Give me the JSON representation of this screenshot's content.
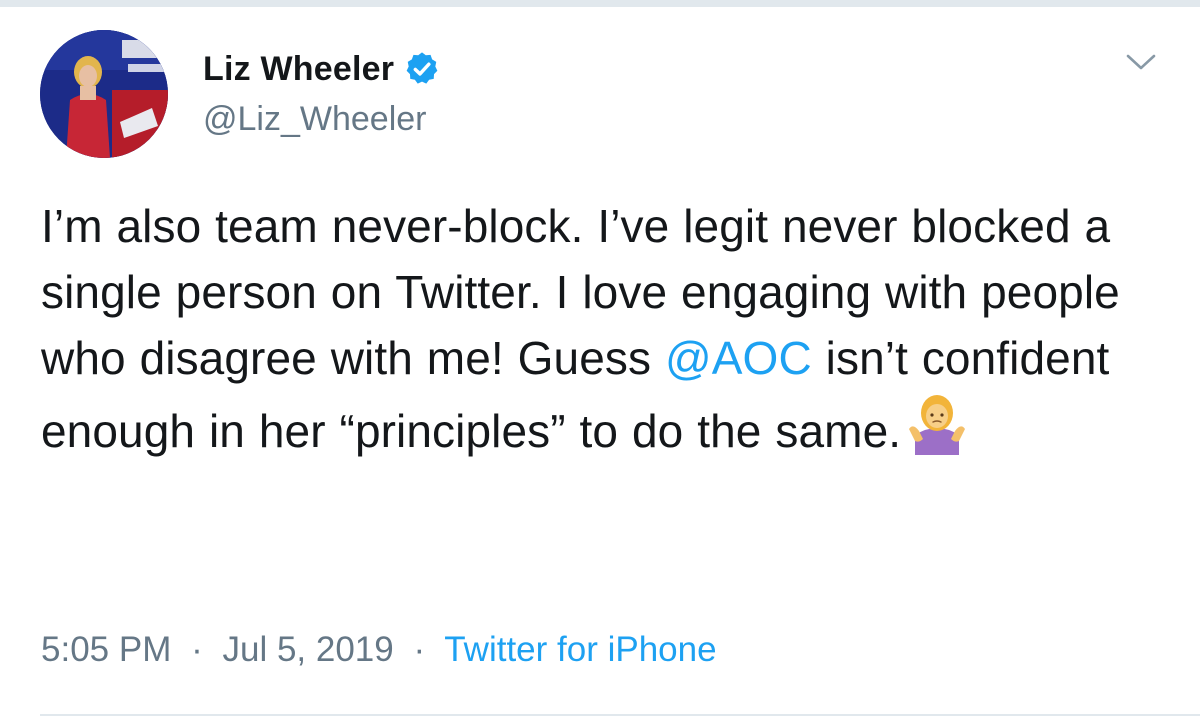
{
  "tweet": {
    "author": {
      "display_name": "Liz Wheeler",
      "handle": "@Liz_Wheeler",
      "verified": true
    },
    "text": {
      "part1": "I’m also team never-block. I’ve legit never blocked a single person on Twitter. I love engaging with people who disagree with me! Guess ",
      "mention": "@AOC",
      "part2": " isn’t confident enough in her “principles” to do the same."
    },
    "emoji": "person-shrugging-emoji",
    "time": "5:05 PM",
    "separator": "·",
    "date": "Jul 5, 2019",
    "source": "Twitter for iPhone"
  },
  "icons": {
    "verified": "verified-badge-icon",
    "menu": "chevron-down-icon"
  },
  "colors": {
    "text": "#14171a",
    "secondary": "#657786",
    "link": "#1da1f2",
    "divider": "#e1e8ed"
  }
}
